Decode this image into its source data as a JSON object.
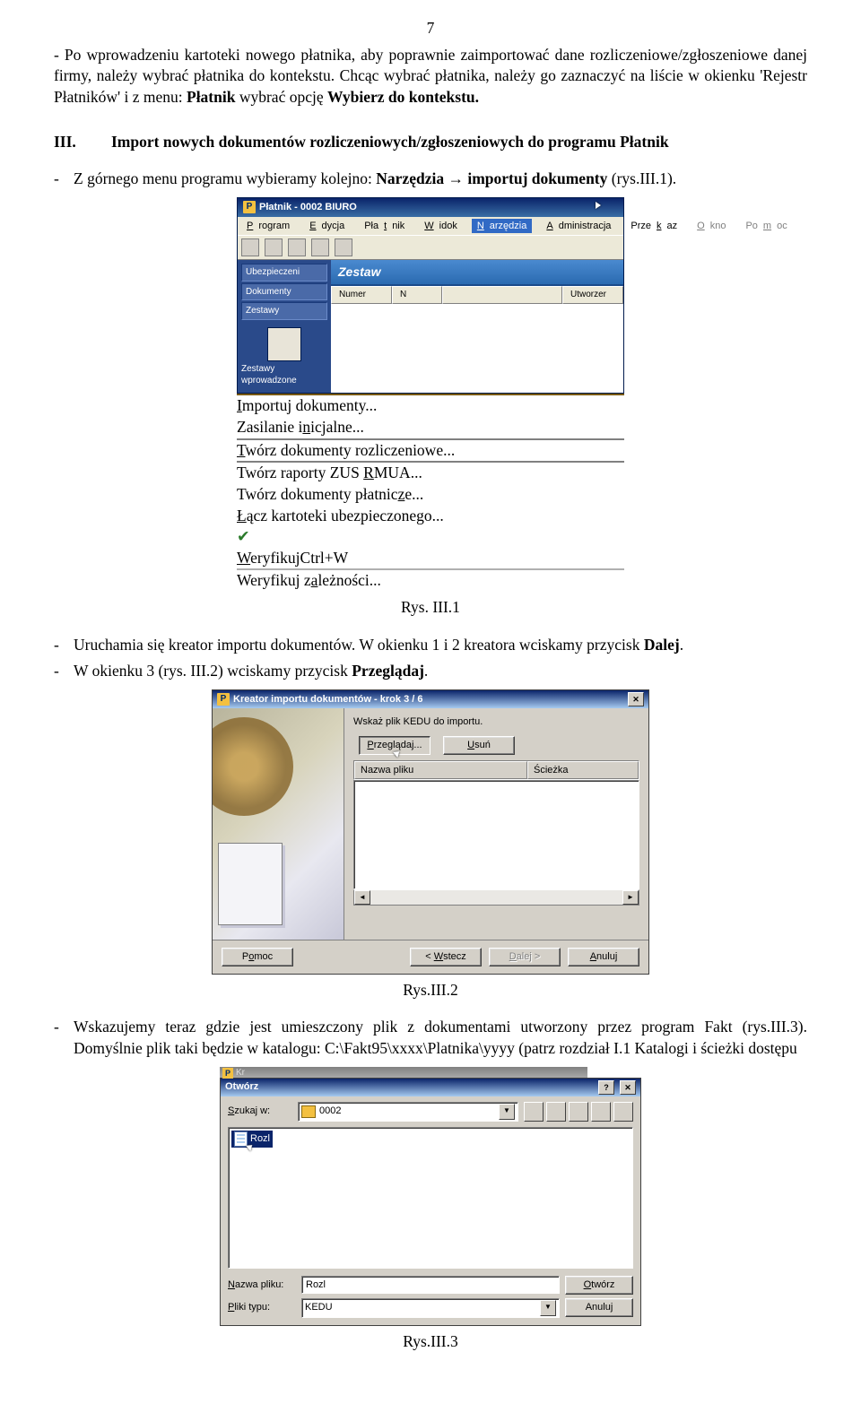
{
  "page": {
    "number": "7"
  },
  "intro": {
    "part1": "- Po wprowadzeniu kartoteki nowego płatnika, aby poprawnie zaimportować dane rozliczeniowe/zgłoszeniowe danej firmy, należy wybrać płatnika do kontekstu. Chcąc wybrać płatnika, należy go zaznaczyć na liście w okienku 'Rejestr Płatników' i z menu:",
    "bold1": "Płatnik",
    "part2": "wybrać opcję",
    "bold2": "Wybierz do kontekstu."
  },
  "section": {
    "roman": "III.",
    "title": "Import nowych dokumentów rozliczeniowych/zgłoszeniowych do programu Płatnik"
  },
  "bullets": [
    {
      "part1": "Z górnego menu programu wybieramy kolejno:",
      "bold1": "Narzędzia → importuj dokumenty",
      "part2": "(rys.III.1)."
    },
    {
      "part1": "Uruchamia się kreator importu dokumentów. W okienku 1 i 2 kreatora wciskamy przycisk",
      "bold1": "Dalej"
    },
    {
      "part1": "W okienku 3 (rys. III.2) wciskamy przycisk",
      "bold1": "Przeglądaj"
    },
    {
      "part1": "Wskazujemy teraz gdzie jest umieszczony plik z dokumentami utworzony przez program Fakt (rys.III.3). Domyślnie plik taki  będzie w katalogu: C:\\Fakt95\\xxxx\\Platnika\\yyyy (patrz rozdział I.1 Katalogi i ścieżki dostępu"
    }
  ],
  "fig1": {
    "title": "Płatnik - 0002 BIURO",
    "menu": [
      {
        "u": "P",
        "r": "rogram"
      },
      {
        "u": "E",
        "r": "dycja"
      },
      {
        "r1": "Pła",
        "u": "t",
        "r2": "nik"
      },
      {
        "u": "W",
        "r": "idok"
      },
      {
        "u": "N",
        "r": "arzędzia"
      },
      {
        "u": "A",
        "r": "dministracja"
      },
      {
        "r1": "Prze",
        "u": "k",
        "r2": "az"
      },
      {
        "u": "O",
        "r": "kno"
      },
      {
        "r1": "Po",
        "u": "m",
        "r2": "oc"
      }
    ],
    "sidebar": [
      "Ubezpieczeni",
      "Dokumenty",
      "Zestawy",
      "Zestawy wprowadzone"
    ],
    "tab": "Zestaw",
    "cols": [
      "Numer",
      "N",
      "Utworzer"
    ],
    "dd": [
      {
        "u": "I",
        "r": "mportuj dokumenty..."
      },
      {
        "r1": "Zasilanie i",
        "u": "n",
        "r2": "icjalne..."
      },
      {
        "u": "T",
        "r": "wórz dokumenty rozliczeniowe..."
      },
      {
        "r1": "Twórz raporty ZUS ",
        "u": "R",
        "r2": "MUA..."
      },
      {
        "r1": "Twórz dokumenty płatnic",
        "u": "z",
        "r2": "e..."
      },
      {
        "u": "Ł",
        "r": "ącz kartoteki ubezpieczonego..."
      },
      {
        "u": "W",
        "r": "eryfikuj",
        "shortcut": "Ctrl+W"
      },
      {
        "r1": "Weryfikuj z",
        "u": "a",
        "r2": "leżności..."
      }
    ],
    "caption": "Rys. III.1"
  },
  "fig2": {
    "title": "Kreator importu dokumentów - krok 3 / 6",
    "instruction": "Wskaż plik KEDU do importu.",
    "btn_browse": {
      "u": "P",
      "r": "rzeglądaj..."
    },
    "btn_delete": {
      "u": "U",
      "r": "suń"
    },
    "cols": [
      "Nazwa pliku",
      "Ścieżka"
    ],
    "btn_help": {
      "r1": "P",
      "u": "o",
      "r2": "moc"
    },
    "btn_back": {
      "prefix": "<",
      "u": "W",
      "r": "stecz"
    },
    "btn_next": {
      "u": "D",
      "r": "alej",
      "suffix": ">"
    },
    "btn_cancel": {
      "u": "A",
      "r": "nuluj"
    },
    "caption": "Rys.III.2"
  },
  "fig3": {
    "behind": "Kr",
    "title": "Otwórz",
    "lookin": {
      "u": "S",
      "r": "zukaj w:"
    },
    "folder": "0002",
    "file": "Rozl",
    "filename_lbl": {
      "u": "N",
      "r": "azwa pliku:"
    },
    "filename_val": "Rozl",
    "filetype_lbl": {
      "u": "P",
      "r": "liki typu:"
    },
    "filetype_val": "KEDU",
    "btn_open": {
      "u": "O",
      "r": "twórz"
    },
    "btn_cancel": "Anuluj",
    "caption": "Rys.III.3"
  }
}
